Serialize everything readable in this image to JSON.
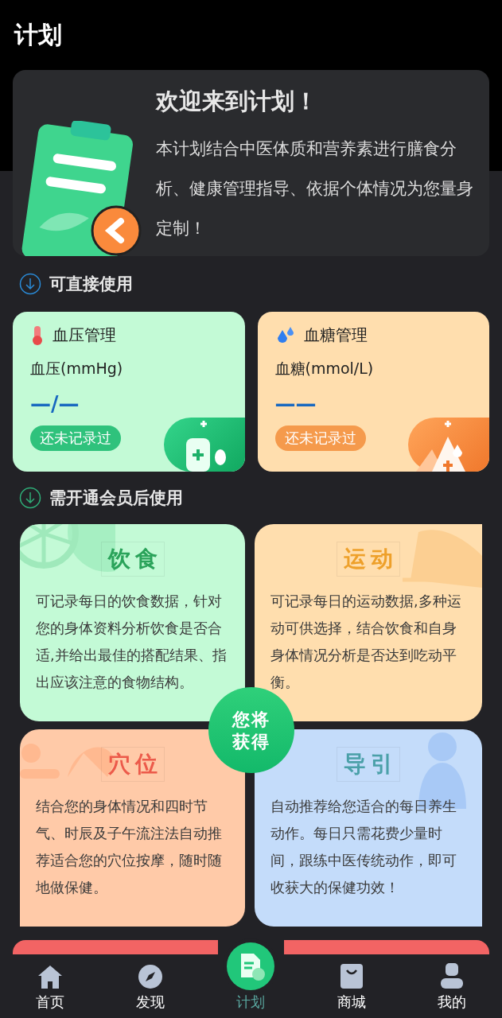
{
  "header": {
    "title": "计划"
  },
  "welcome": {
    "title": "欢迎来到计划！",
    "body": "本计划结合中医体质和营养素进行膳食分析、健康管理指导、依据个体情况为您量身定制！"
  },
  "direct": {
    "title": "可直接使用",
    "items": [
      {
        "kind": "pressure",
        "title": "血压管理",
        "unit": "血压(mmHg)",
        "value": "—/—",
        "status": "还未记录过"
      },
      {
        "kind": "sugar",
        "title": "血糖管理",
        "unit": "血糖(mmol/L)",
        "value": "——",
        "status": "还未记录过"
      }
    ]
  },
  "member": {
    "title": "需开通会员后使用",
    "badge_lines": [
      "您将",
      "获得"
    ],
    "items": [
      {
        "kind": "diet",
        "title": "饮食",
        "body": "可记录每日的饮食数据，针对您的身体资料分析饮食是否合适,并给出最佳的搭配结果、指出应该注意的食物结构。"
      },
      {
        "kind": "sport",
        "title": "运动",
        "body": "可记录每日的运动数据,多种运动可供选择，结合饮食和自身身体情况分析是否达到吃动平衡。"
      },
      {
        "kind": "acupoint",
        "title": "穴位",
        "body": "结合您的身体情况和四时节气、时辰及子午流注法自动推荐适合您的穴位按摩，随时随地做保健。"
      },
      {
        "kind": "daoyin",
        "title": "导引",
        "body": "自动推荐给您适合的每日养生动作。每日只需花费少量时间，跟练中医传统动作，即可收获大的保健功效！"
      }
    ]
  },
  "nav": [
    {
      "kind": "home",
      "label": "首页",
      "selected": false
    },
    {
      "kind": "discover",
      "label": "发现",
      "selected": false
    },
    {
      "kind": "plan",
      "label": "计划",
      "selected": true
    },
    {
      "kind": "shop",
      "label": "商城",
      "selected": false
    },
    {
      "kind": "me",
      "label": "我的",
      "selected": false
    }
  ]
}
